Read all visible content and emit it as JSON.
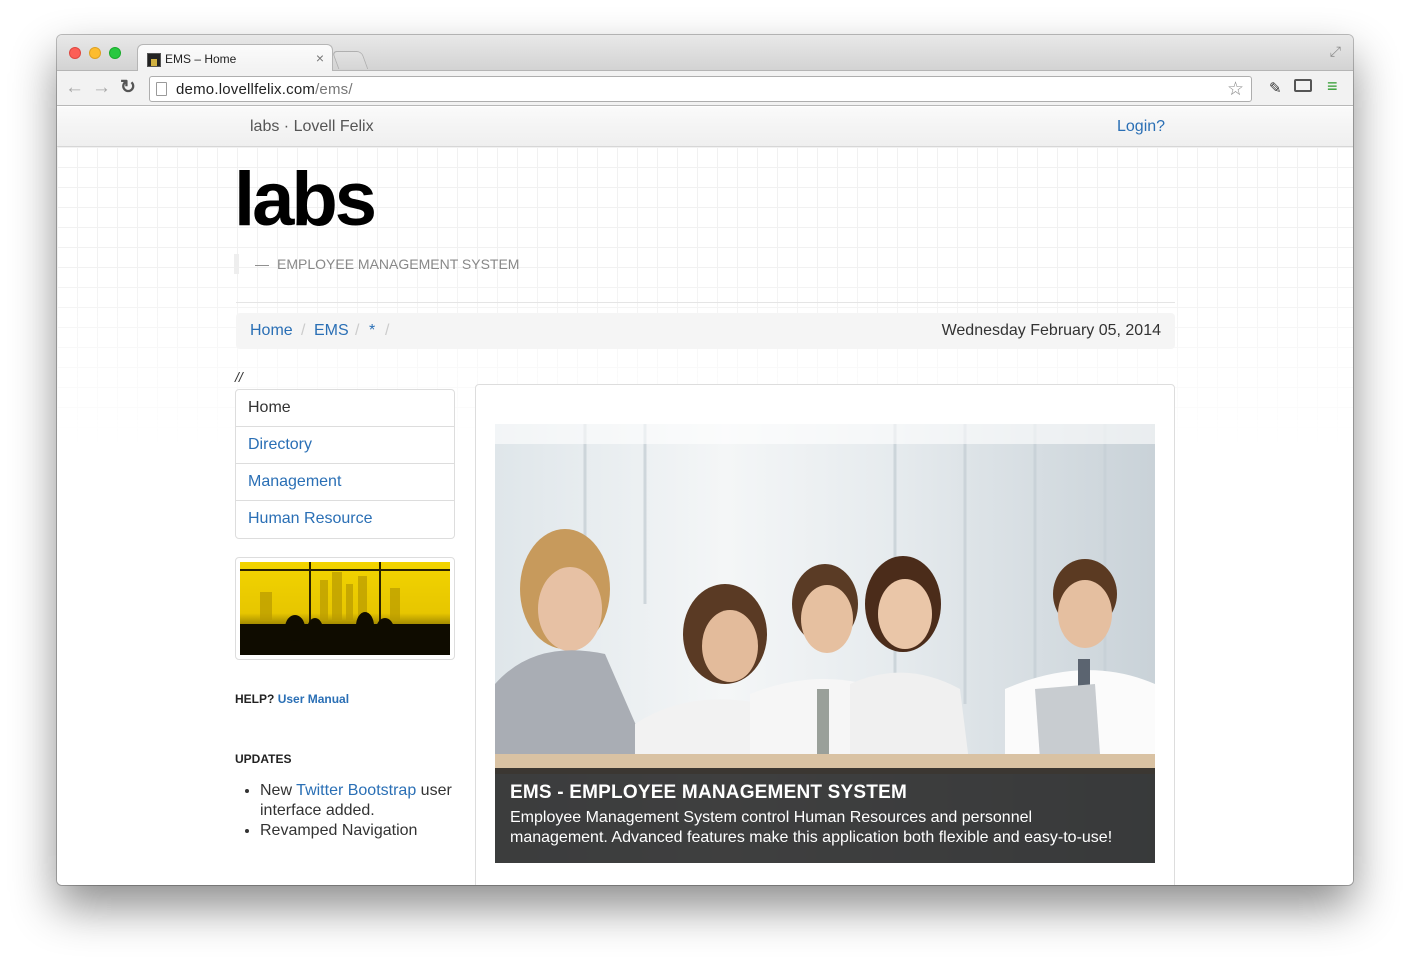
{
  "browser": {
    "tab_title": "EMS – Home",
    "url_host": "demo.lovellfelix.com",
    "url_path": "/ems/"
  },
  "navbar": {
    "brand": "labs · Lovell Felix",
    "login": "Login?"
  },
  "header": {
    "logo": "labs",
    "tagline_dash": "—",
    "tagline": "EMPLOYEE MANAGEMENT SYSTEM"
  },
  "breadcrumb": {
    "items": [
      "Home",
      "EMS",
      "*"
    ],
    "separator": "/",
    "date": "Wednesday February 05, 2014"
  },
  "comment": "//",
  "sidenav": {
    "items": [
      {
        "label": "Home"
      },
      {
        "label": "Directory"
      },
      {
        "label": "Management"
      },
      {
        "label": "Human Resource"
      }
    ]
  },
  "help": {
    "label": "HELP?",
    "link": "User Manual"
  },
  "updates": {
    "heading": "UPDATES",
    "item1_prefix": "New ",
    "item1_link": "Twitter Bootstrap",
    "item1_suffix": " user interface added.",
    "item2": "Revamped Navigation"
  },
  "hero": {
    "title": "EMS - EMPLOYEE MANAGEMENT SYSTEM",
    "text": "Employee Management System control Human Resources and personnel management. Advanced features make this application both flexible and easy-to-use!"
  },
  "colors": {
    "link": "#2a6fb5",
    "caption_bg": "#1e1e1e"
  }
}
